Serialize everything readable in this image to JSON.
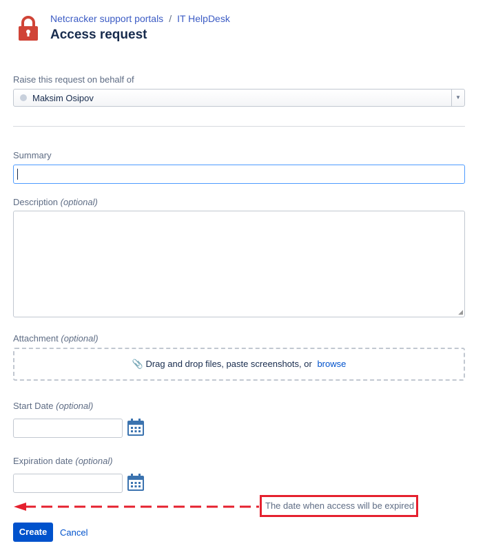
{
  "header": {
    "breadcrumb": [
      "Netcracker support portals",
      "IT HelpDesk"
    ],
    "separator": "/",
    "title": "Access request",
    "icon": "lock-icon",
    "icon_color": "#d04437"
  },
  "behalf": {
    "label": "Raise this request on behalf of",
    "value": "Maksim Osipov"
  },
  "summary": {
    "label": "Summary",
    "value": ""
  },
  "description": {
    "label": "Description",
    "optional": "(optional)",
    "value": ""
  },
  "attachment": {
    "label": "Attachment",
    "optional": "(optional)",
    "text": "Drag and drop files, paste screenshots, or",
    "browse": "browse"
  },
  "start_date": {
    "label": "Start Date",
    "optional": "(optional)",
    "value": ""
  },
  "expiration_date": {
    "label": "Expiration date",
    "optional": "(optional)",
    "value": ""
  },
  "annotation": {
    "text": "The date when access will be expired",
    "color": "#e5202e"
  },
  "actions": {
    "create": "Create",
    "cancel": "Cancel"
  }
}
